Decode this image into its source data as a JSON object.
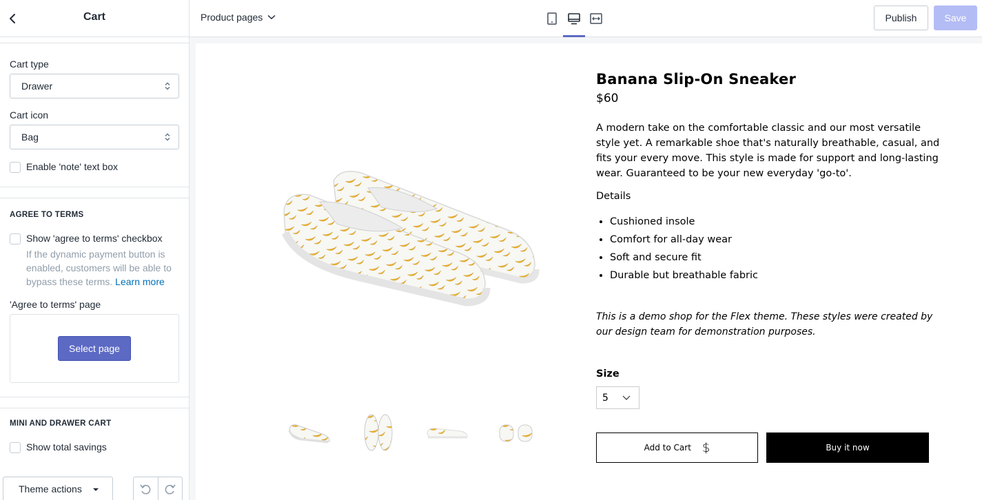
{
  "sidebar": {
    "title": "Cart",
    "cart_type": {
      "label": "Cart type",
      "value": "Drawer"
    },
    "cart_icon": {
      "label": "Cart icon",
      "value": "Bag"
    },
    "note_checkbox": {
      "label": "Enable 'note' text box",
      "checked": false
    },
    "terms": {
      "heading": "AGREE TO TERMS",
      "checkbox_label": "Show 'agree to terms' checkbox",
      "help_text": "If the dynamic payment button is enabled, customers will be able to bypass these terms.",
      "help_link": "Learn more",
      "page_label": "'Agree to terms' page",
      "select_page_button": "Select page"
    },
    "mini_cart": {
      "heading": "MINI AND DRAWER CART",
      "checkbox_label": "Show total savings"
    },
    "footer": {
      "theme_actions": "Theme actions"
    }
  },
  "topbar": {
    "page_selector": "Product pages",
    "publish": "Publish",
    "save": "Save",
    "active_view": "desktop"
  },
  "product": {
    "title": "Banana Slip-On Sneaker",
    "price": "$60",
    "description": "A modern take on the comfortable classic and our most versatile style yet. A remarkable shoe that's naturally breathable, casual, and fits your every move. This style is made for support and long-lasting wear. Guaranteed to be your new everyday 'go-to'.",
    "details_heading": "Details",
    "details": [
      "Cushioned insole",
      "Comfort for all-day wear",
      "Soft and secure fit",
      "Durable but breathable fabric"
    ],
    "note": "This is a demo shop for the Flex theme. These styles were created by our design team for demonstration purposes.",
    "size_label": "Size",
    "size_value": "5",
    "add_to_cart": "Add to Cart",
    "add_to_cart_icon": "$",
    "buy_now": "Buy it now"
  },
  "colors": {
    "accent": "#5c6ac4",
    "save_disabled": "#b3bcf5",
    "banana": "#f2b632"
  }
}
